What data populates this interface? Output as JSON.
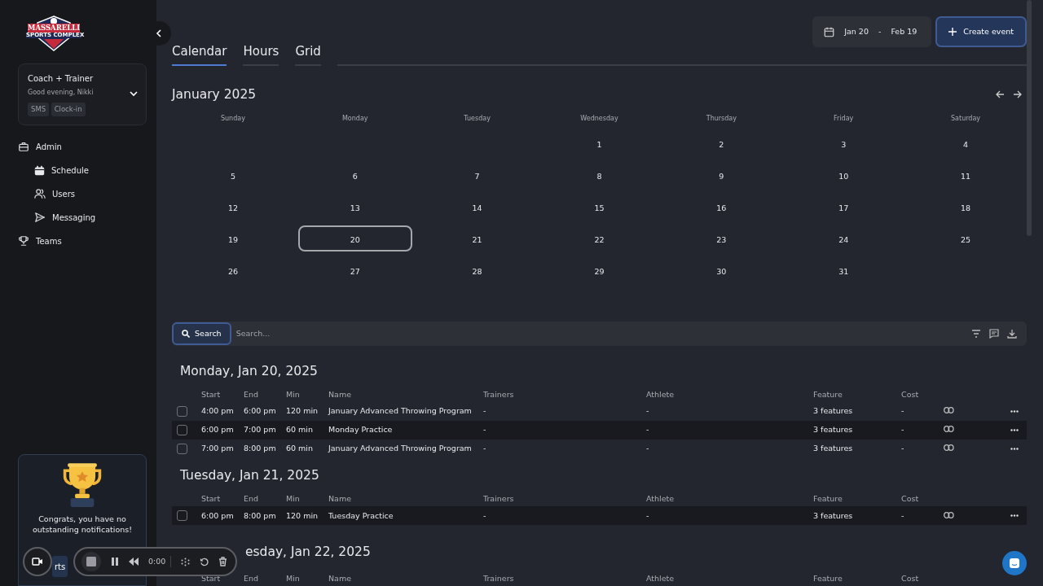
{
  "sidebar": {
    "logo_text": "MASSARELLI",
    "logo_subtext": "SPORTS COMPLEX",
    "account": {
      "role": "Coach + Trainer",
      "greeting": "Good evening, Nikki",
      "tags": [
        "SMS",
        "Clock-in"
      ]
    },
    "nav": [
      {
        "label": "Admin",
        "kind": "briefcase",
        "children": [
          {
            "label": "Schedule",
            "kind": "calendar"
          },
          {
            "label": "Users",
            "kind": "users"
          },
          {
            "label": "Messaging",
            "kind": "send"
          }
        ]
      },
      {
        "label": "Teams",
        "kind": "trophy"
      }
    ],
    "notification": {
      "message": "Congrats, you have no outstanding notifications!",
      "button": "rts"
    }
  },
  "recorder": {
    "time": "0:00"
  },
  "header": {
    "date_from": "Jan 20",
    "date_separator": "-",
    "date_to": "Feb 19",
    "create_button": "Create event"
  },
  "tabs": [
    {
      "label": "Calendar",
      "selected": true
    },
    {
      "label": "Hours",
      "selected": false
    },
    {
      "label": "Grid",
      "selected": false
    }
  ],
  "calendar": {
    "title": "January 2025",
    "weekdays": [
      "Sunday",
      "Monday",
      "Tuesday",
      "Wednesday",
      "Thursday",
      "Friday",
      "Saturday"
    ],
    "weeks": [
      {
        "kind": "leading",
        "days": [
          {
            "day": "1",
            "selected": false
          },
          {
            "day": "2",
            "selected": false
          },
          {
            "day": "3",
            "selected": false
          },
          {
            "day": "4",
            "selected": false
          }
        ]
      },
      {
        "kind": "full",
        "days": [
          {
            "day": "5",
            "selected": false
          },
          {
            "day": "6",
            "selected": false
          },
          {
            "day": "7",
            "selected": false
          },
          {
            "day": "8",
            "selected": false
          },
          {
            "day": "9",
            "selected": false
          },
          {
            "day": "10",
            "selected": false
          },
          {
            "day": "11",
            "selected": false
          }
        ]
      },
      {
        "kind": "full",
        "days": [
          {
            "day": "12",
            "selected": false
          },
          {
            "day": "13",
            "selected": false
          },
          {
            "day": "14",
            "selected": false
          },
          {
            "day": "15",
            "selected": false
          },
          {
            "day": "16",
            "selected": false
          },
          {
            "day": "17",
            "selected": false
          },
          {
            "day": "18",
            "selected": false
          }
        ]
      },
      {
        "kind": "full",
        "days": [
          {
            "day": "19",
            "selected": false
          },
          {
            "day": "20",
            "selected": true
          },
          {
            "day": "21",
            "selected": false
          },
          {
            "day": "22",
            "selected": false
          },
          {
            "day": "23",
            "selected": false
          },
          {
            "day": "24",
            "selected": false
          },
          {
            "day": "25",
            "selected": false
          }
        ]
      },
      {
        "kind": "trailing",
        "days": [
          {
            "day": "26",
            "selected": false
          },
          {
            "day": "27",
            "selected": false
          },
          {
            "day": "28",
            "selected": false
          },
          {
            "day": "29",
            "selected": false
          },
          {
            "day": "30",
            "selected": false
          },
          {
            "day": "31",
            "selected": false
          }
        ]
      }
    ]
  },
  "search": {
    "button": "Search",
    "placeholder": "Search..."
  },
  "day_groups": [
    {
      "heading": "Monday, Jan 20, 2025",
      "columns": [
        "Start",
        "End",
        "Min",
        "Name",
        "Trainers",
        "Athlete",
        "Feature",
        "Cost"
      ],
      "rows": [
        {
          "start": "4:00 pm",
          "end": "6:00 pm",
          "min": "120 min",
          "name": "January Advanced Throwing Program",
          "trainers": "-",
          "athlete": "-",
          "feature": "3 features",
          "cost": "-",
          "checked": false,
          "shaded": false
        },
        {
          "start": "6:00 pm",
          "end": "7:00 pm",
          "min": "60 min",
          "name": "Monday Practice",
          "trainers": "-",
          "athlete": "-",
          "feature": "3 features",
          "cost": "-",
          "checked": false,
          "shaded": true
        },
        {
          "start": "7:00 pm",
          "end": "8:00 pm",
          "min": "60 min",
          "name": "January Advanced Throwing Program",
          "trainers": "-",
          "athlete": "-",
          "feature": "3 features",
          "cost": "-",
          "checked": false,
          "shaded": false
        }
      ]
    },
    {
      "heading": "Tuesday, Jan 21, 2025",
      "columns": [
        "Start",
        "End",
        "Min",
        "Name",
        "Trainers",
        "Athlete",
        "Feature",
        "Cost"
      ],
      "rows": [
        {
          "start": "6:00 pm",
          "end": "8:00 pm",
          "min": "120 min",
          "name": "Tuesday Practice",
          "trainers": "-",
          "athlete": "-",
          "feature": "3 features",
          "cost": "-",
          "checked": false,
          "shaded": true
        }
      ]
    },
    {
      "heading": "esday, Jan 22, 2025",
      "columns": [
        "Start",
        "End",
        "Min",
        "Name",
        "Trainers",
        "Athlete",
        "Feature",
        "Cost"
      ]
    }
  ]
}
